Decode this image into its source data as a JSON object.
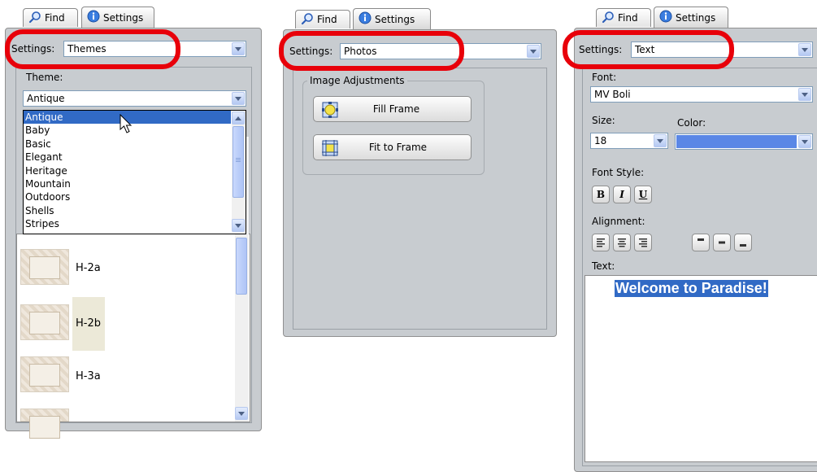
{
  "tabs": {
    "find": "Find",
    "settings": "Settings"
  },
  "panels": {
    "themes": {
      "settings_label": "Settings:",
      "settings_value": "Themes",
      "theme_label": "Theme:",
      "theme_value": "Antique",
      "dropdown_options": [
        "Antique",
        "Baby",
        "Basic",
        "Elegant",
        "Heritage",
        "Mountain",
        "Outdoors",
        "Shells",
        "Stripes"
      ],
      "selected_option": "Antique",
      "thumbnails": [
        "H-2a",
        "H-2b",
        "H-3a"
      ]
    },
    "photos": {
      "settings_label": "Settings:",
      "settings_value": "Photos",
      "group_label": "Image Adjustments",
      "fill_frame": "Fill Frame",
      "fit_to_frame": "Fit to Frame"
    },
    "text": {
      "settings_label": "Settings:",
      "settings_value": "Text",
      "font_label": "Font:",
      "font_value": "MV Boli",
      "size_label": "Size:",
      "size_value": "18",
      "color_label": "Color:",
      "font_style_label": "Font Style:",
      "bold": "B",
      "italic": "I",
      "underline": "U",
      "alignment_label": "Alignment:",
      "text_label": "Text:",
      "text_value": "Welcome to Paradise!"
    }
  },
  "colors": {
    "highlight_oval": "#e8000a",
    "selection": "#316ac5",
    "text_color_swatch": "#5a87e6",
    "panel_bg": "#c8ccd0"
  },
  "icons": [
    "search-icon",
    "info-icon",
    "fill-frame-icon",
    "fit-frame-icon",
    "align-left-icon",
    "align-center-icon",
    "align-right-icon",
    "align-top-icon",
    "align-middle-icon",
    "align-bottom-icon",
    "cursor-icon"
  ]
}
